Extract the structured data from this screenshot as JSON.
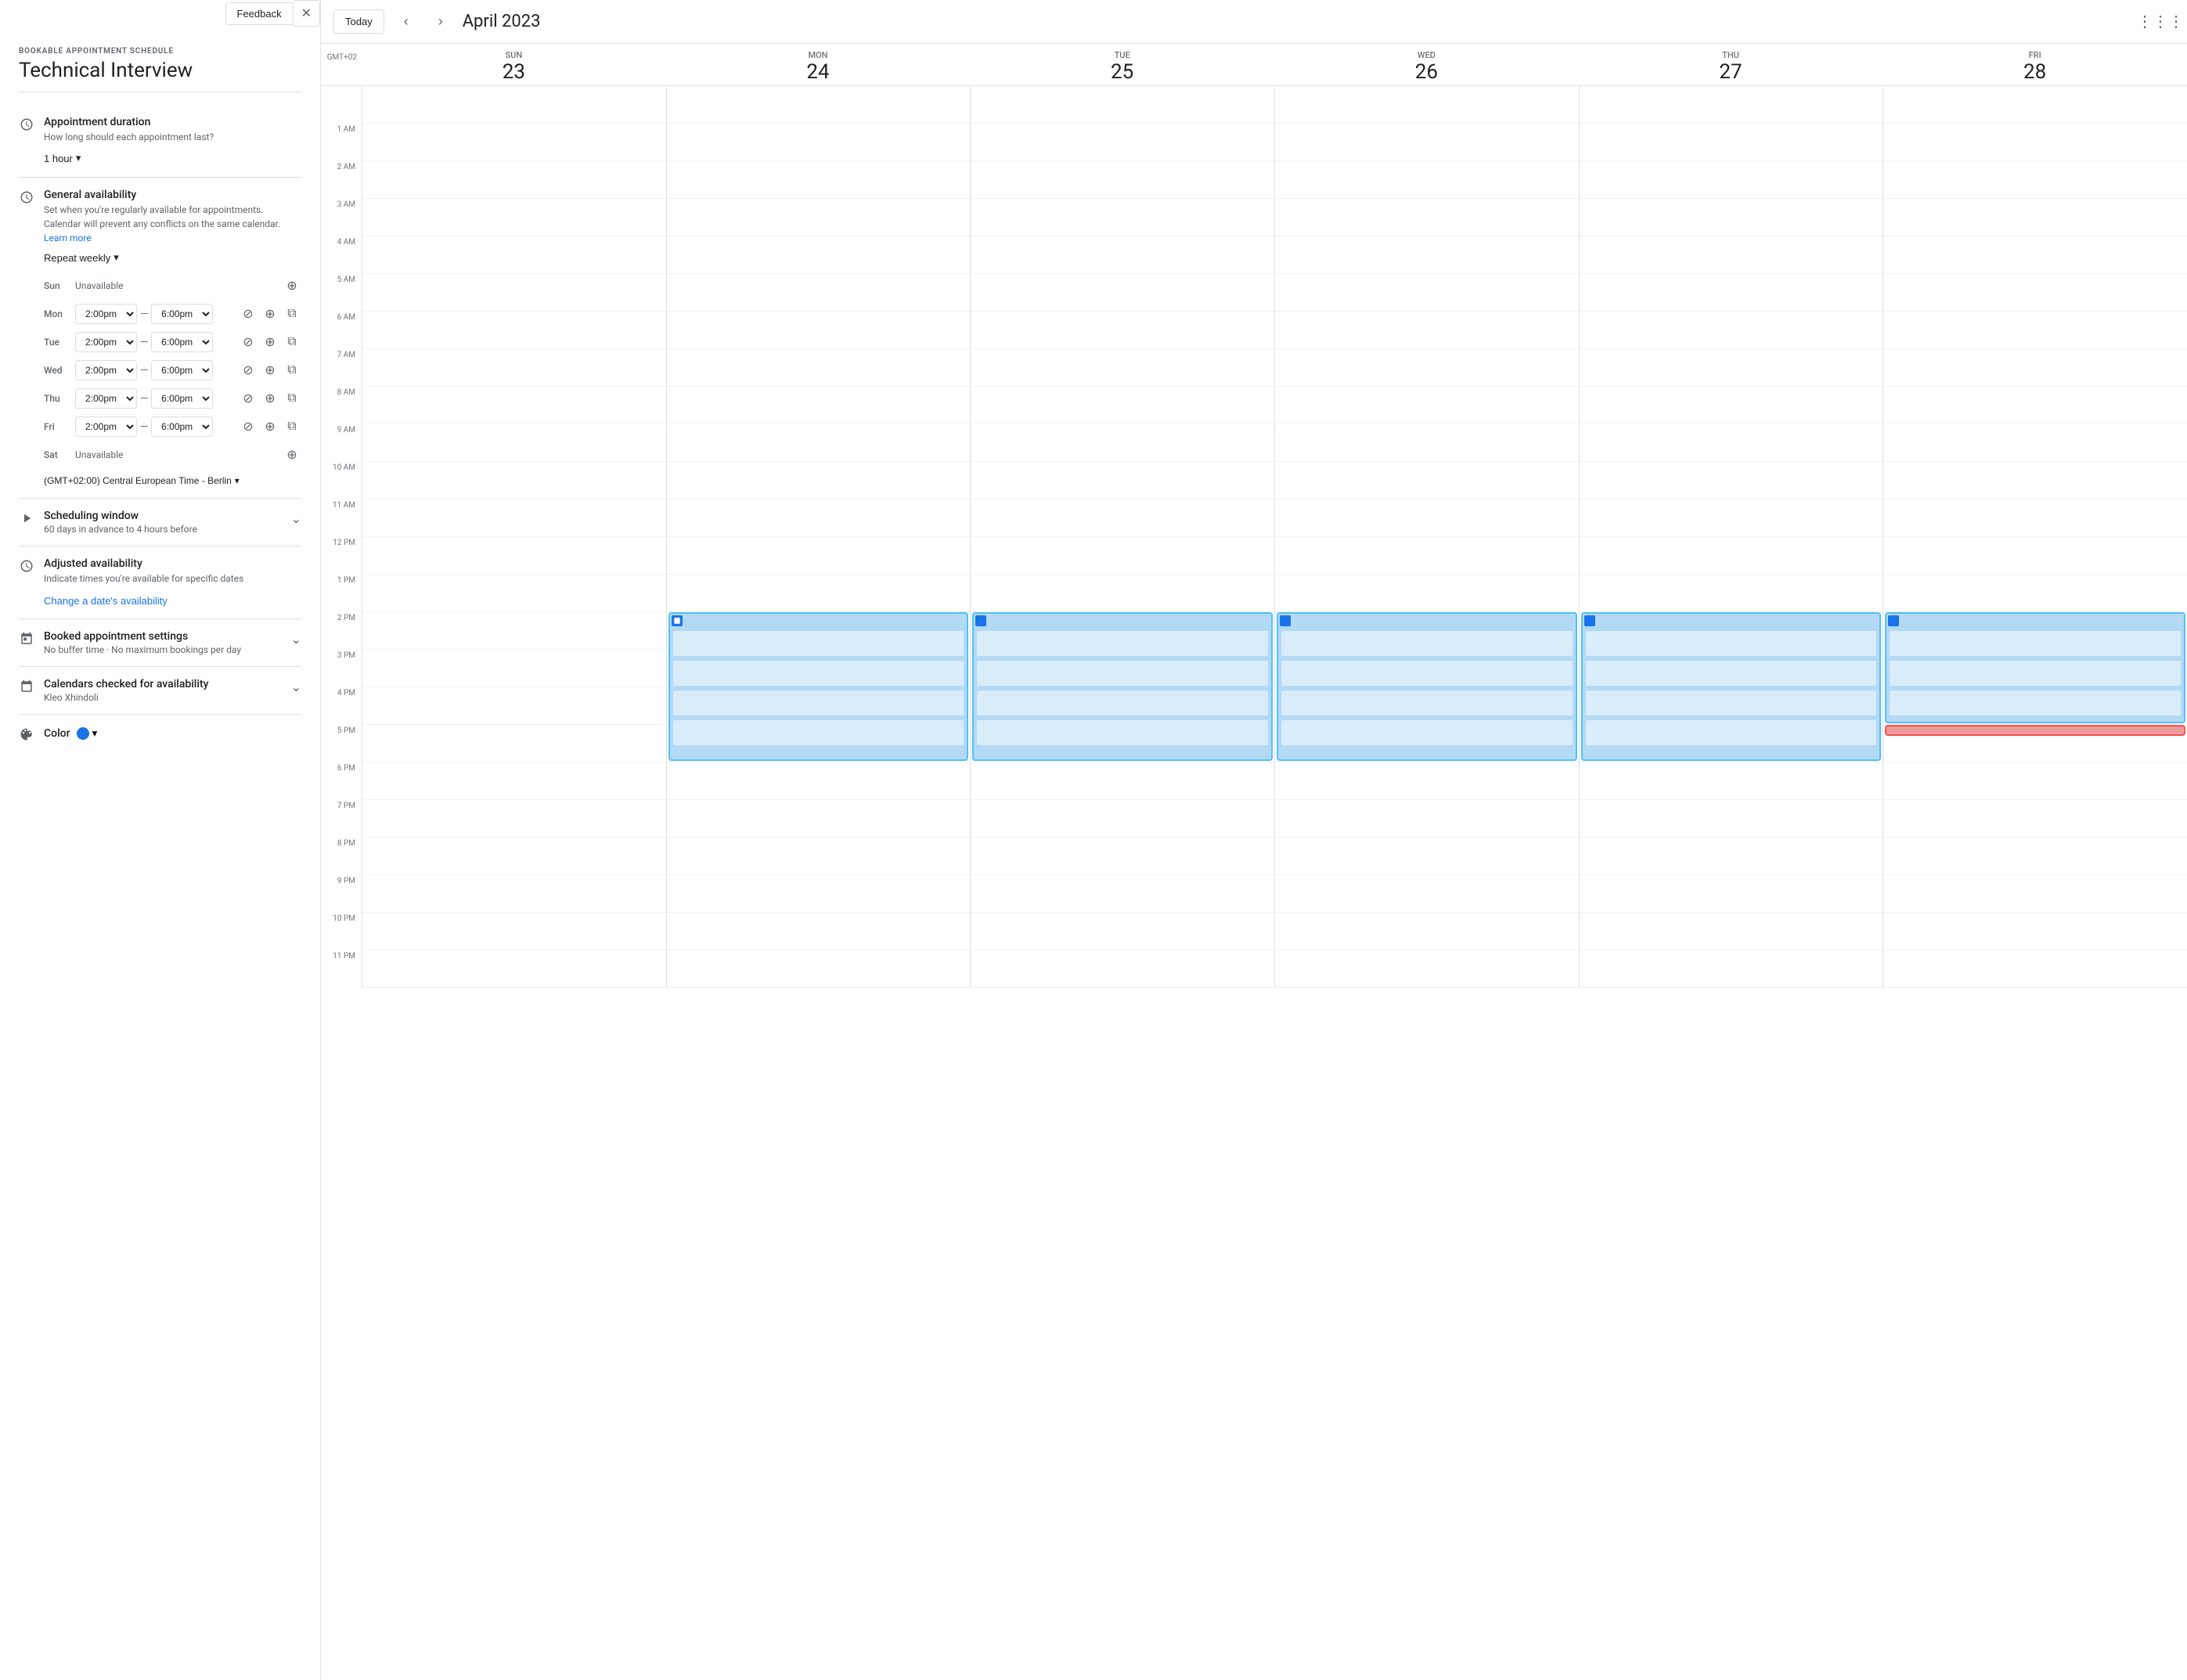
{
  "feedback": {
    "label": "Feedback"
  },
  "left_panel": {
    "bookable_label": "BOOKABLE APPOINTMENT SCHEDULE",
    "title": "Technical Interview",
    "appointment_duration": {
      "title": "Appointment duration",
      "subtitle": "How long should each appointment last?",
      "value": "1 hour",
      "dropdown_arrow": "▾"
    },
    "general_availability": {
      "title": "General availability",
      "subtitle_part1": "Set when you're regularly available for appointments. Calendar will prevent any conflicts on the same calendar.",
      "learn_more": "Learn more",
      "repeat_label": "Repeat weekly",
      "days": [
        {
          "name": "Sun",
          "available": false,
          "start": null,
          "end": null
        },
        {
          "name": "Mon",
          "available": true,
          "start": "2:00pm",
          "end": "6:00pm"
        },
        {
          "name": "Tue",
          "available": true,
          "start": "2:00pm",
          "end": "6:00pm"
        },
        {
          "name": "Wed",
          "available": true,
          "start": "2:00pm",
          "end": "6:00pm"
        },
        {
          "name": "Thu",
          "available": true,
          "start": "2:00pm",
          "end": "6:00pm"
        },
        {
          "name": "Fri",
          "available": true,
          "start": "2:00pm",
          "end": "6:00pm"
        },
        {
          "name": "Sat",
          "available": false,
          "start": null,
          "end": null
        }
      ],
      "timezone": "(GMT+02:00) Central European Time - Berlin"
    },
    "scheduling_window": {
      "title": "Scheduling window",
      "subtitle": "60 days in advance to 4 hours before"
    },
    "adjusted_availability": {
      "title": "Adjusted availability",
      "subtitle": "Indicate times you're available for specific dates",
      "link": "Change a date's availability"
    },
    "booked_settings": {
      "title": "Booked appointment settings",
      "subtitle": "No buffer time · No maximum bookings per day"
    },
    "calendars": {
      "title": "Calendars checked for availability",
      "subtitle": "Kleo Xhindoli"
    },
    "color": {
      "label": "Color",
      "value": "#1a73e8"
    }
  },
  "calendar": {
    "today_label": "Today",
    "month_title": "April 2023",
    "gmt_label": "GMT+02",
    "days": [
      {
        "name": "SUN",
        "num": "23"
      },
      {
        "name": "MON",
        "num": "24"
      },
      {
        "name": "TUE",
        "num": "25"
      },
      {
        "name": "WED",
        "num": "26"
      },
      {
        "name": "THU",
        "num": "27"
      },
      {
        "name": "FRI",
        "num": "28"
      }
    ],
    "time_labels": [
      "",
      "1 AM",
      "2 AM",
      "3 AM",
      "4 AM",
      "5 AM",
      "6 AM",
      "7 AM",
      "8 AM",
      "9 AM",
      "10 AM",
      "11 AM",
      "12 PM",
      "1 PM",
      "2 PM",
      "3 PM",
      "4 PM",
      "5 PM",
      "6 PM",
      "7 PM",
      "8 PM",
      "9 PM",
      "10 PM",
      "11 PM"
    ]
  }
}
